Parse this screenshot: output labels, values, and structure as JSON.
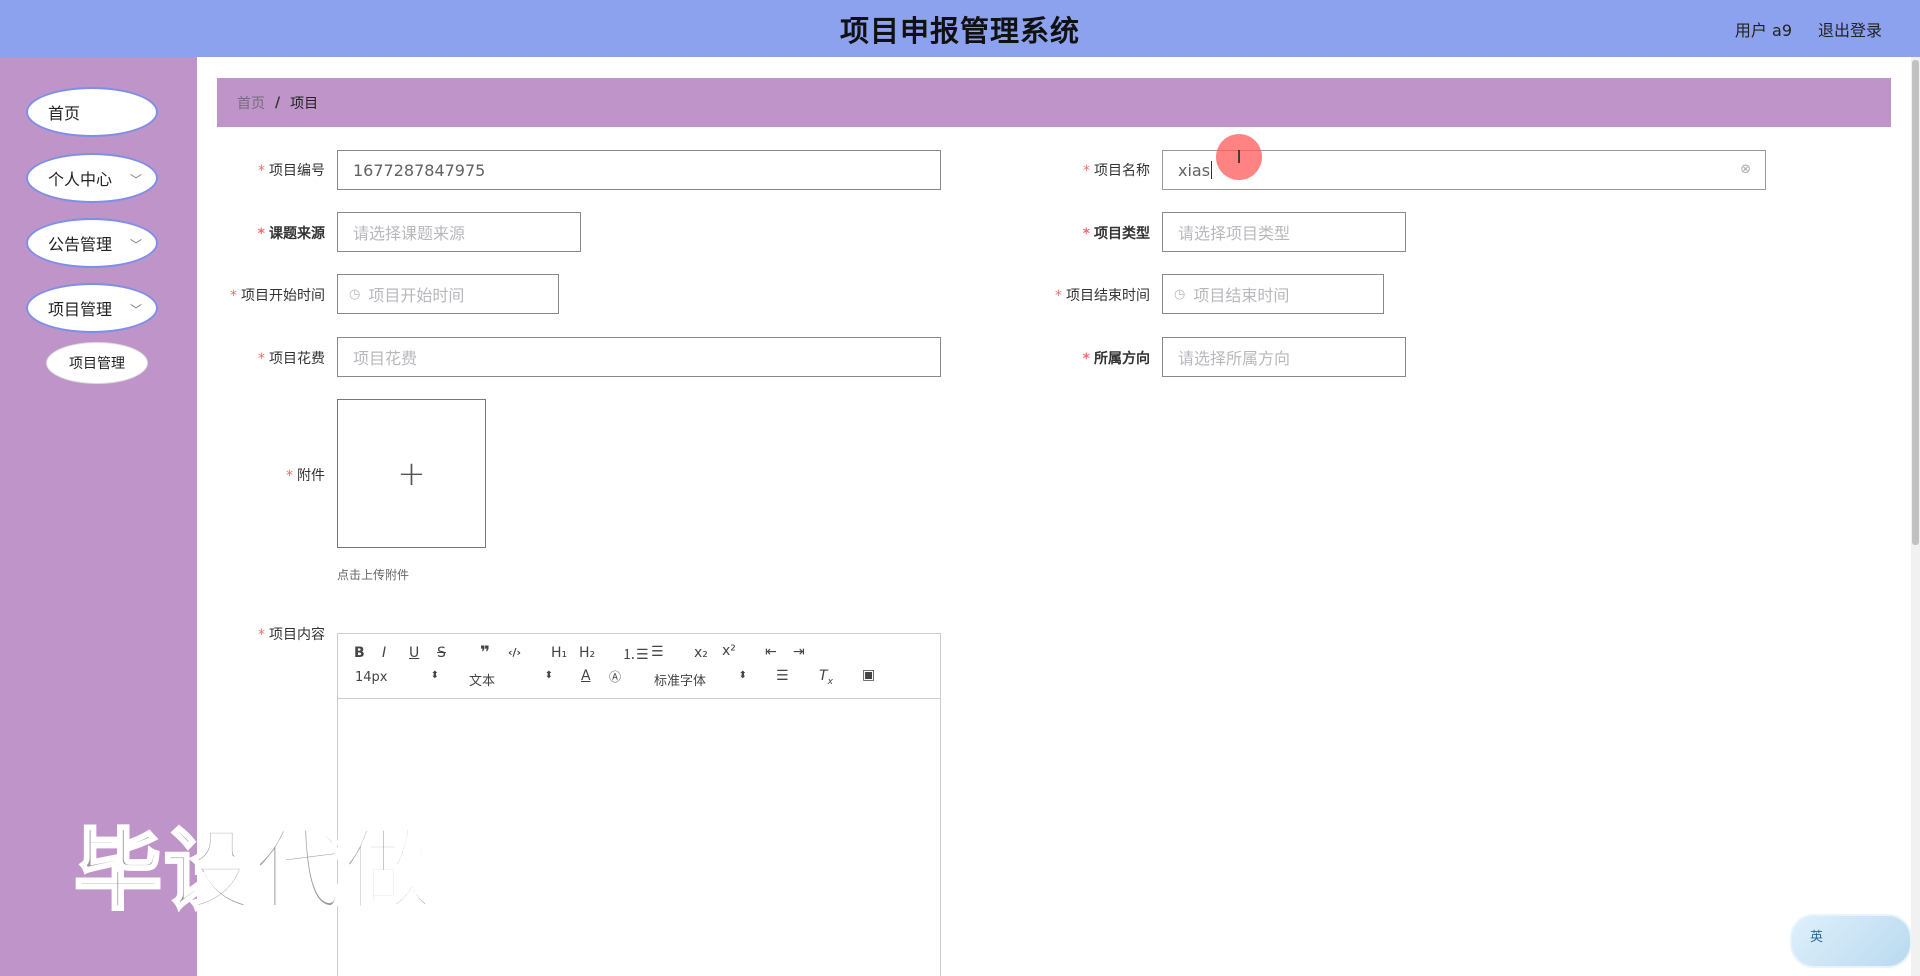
{
  "header": {
    "title": "项目申报管理系统",
    "user": "用户 a9",
    "logout": "退出登录"
  },
  "sidebar": {
    "items": [
      {
        "label": "首页"
      },
      {
        "label": "个人中心"
      },
      {
        "label": "公告管理"
      },
      {
        "label": "项目管理"
      }
    ],
    "sub_item": "项目管理"
  },
  "breadcrumb": {
    "home": "首页",
    "separator": "/",
    "current": "项目"
  },
  "form": {
    "project_no": {
      "label": "项目编号",
      "value": "1677287847975"
    },
    "project_name": {
      "label": "项目名称",
      "value": "xias"
    },
    "source": {
      "label": "课题来源",
      "placeholder": "请选择课题来源"
    },
    "type": {
      "label": "项目类型",
      "placeholder": "请选择项目类型"
    },
    "start_time": {
      "label": "项目开始时间",
      "placeholder": "项目开始时间"
    },
    "end_time": {
      "label": "项目结束时间",
      "placeholder": "项目结束时间"
    },
    "cost": {
      "label": "项目花费",
      "placeholder": "项目花费"
    },
    "direction": {
      "label": "所属方向",
      "placeholder": "请选择所属方向"
    },
    "attachment": {
      "label": "附件",
      "hint": "点击上传附件"
    },
    "content": {
      "label": "项目内容"
    }
  },
  "editor": {
    "font_size": "14px",
    "paragraph": "文本",
    "font_family": "标准字体"
  },
  "watermark": "毕设代做",
  "ime": "英"
}
